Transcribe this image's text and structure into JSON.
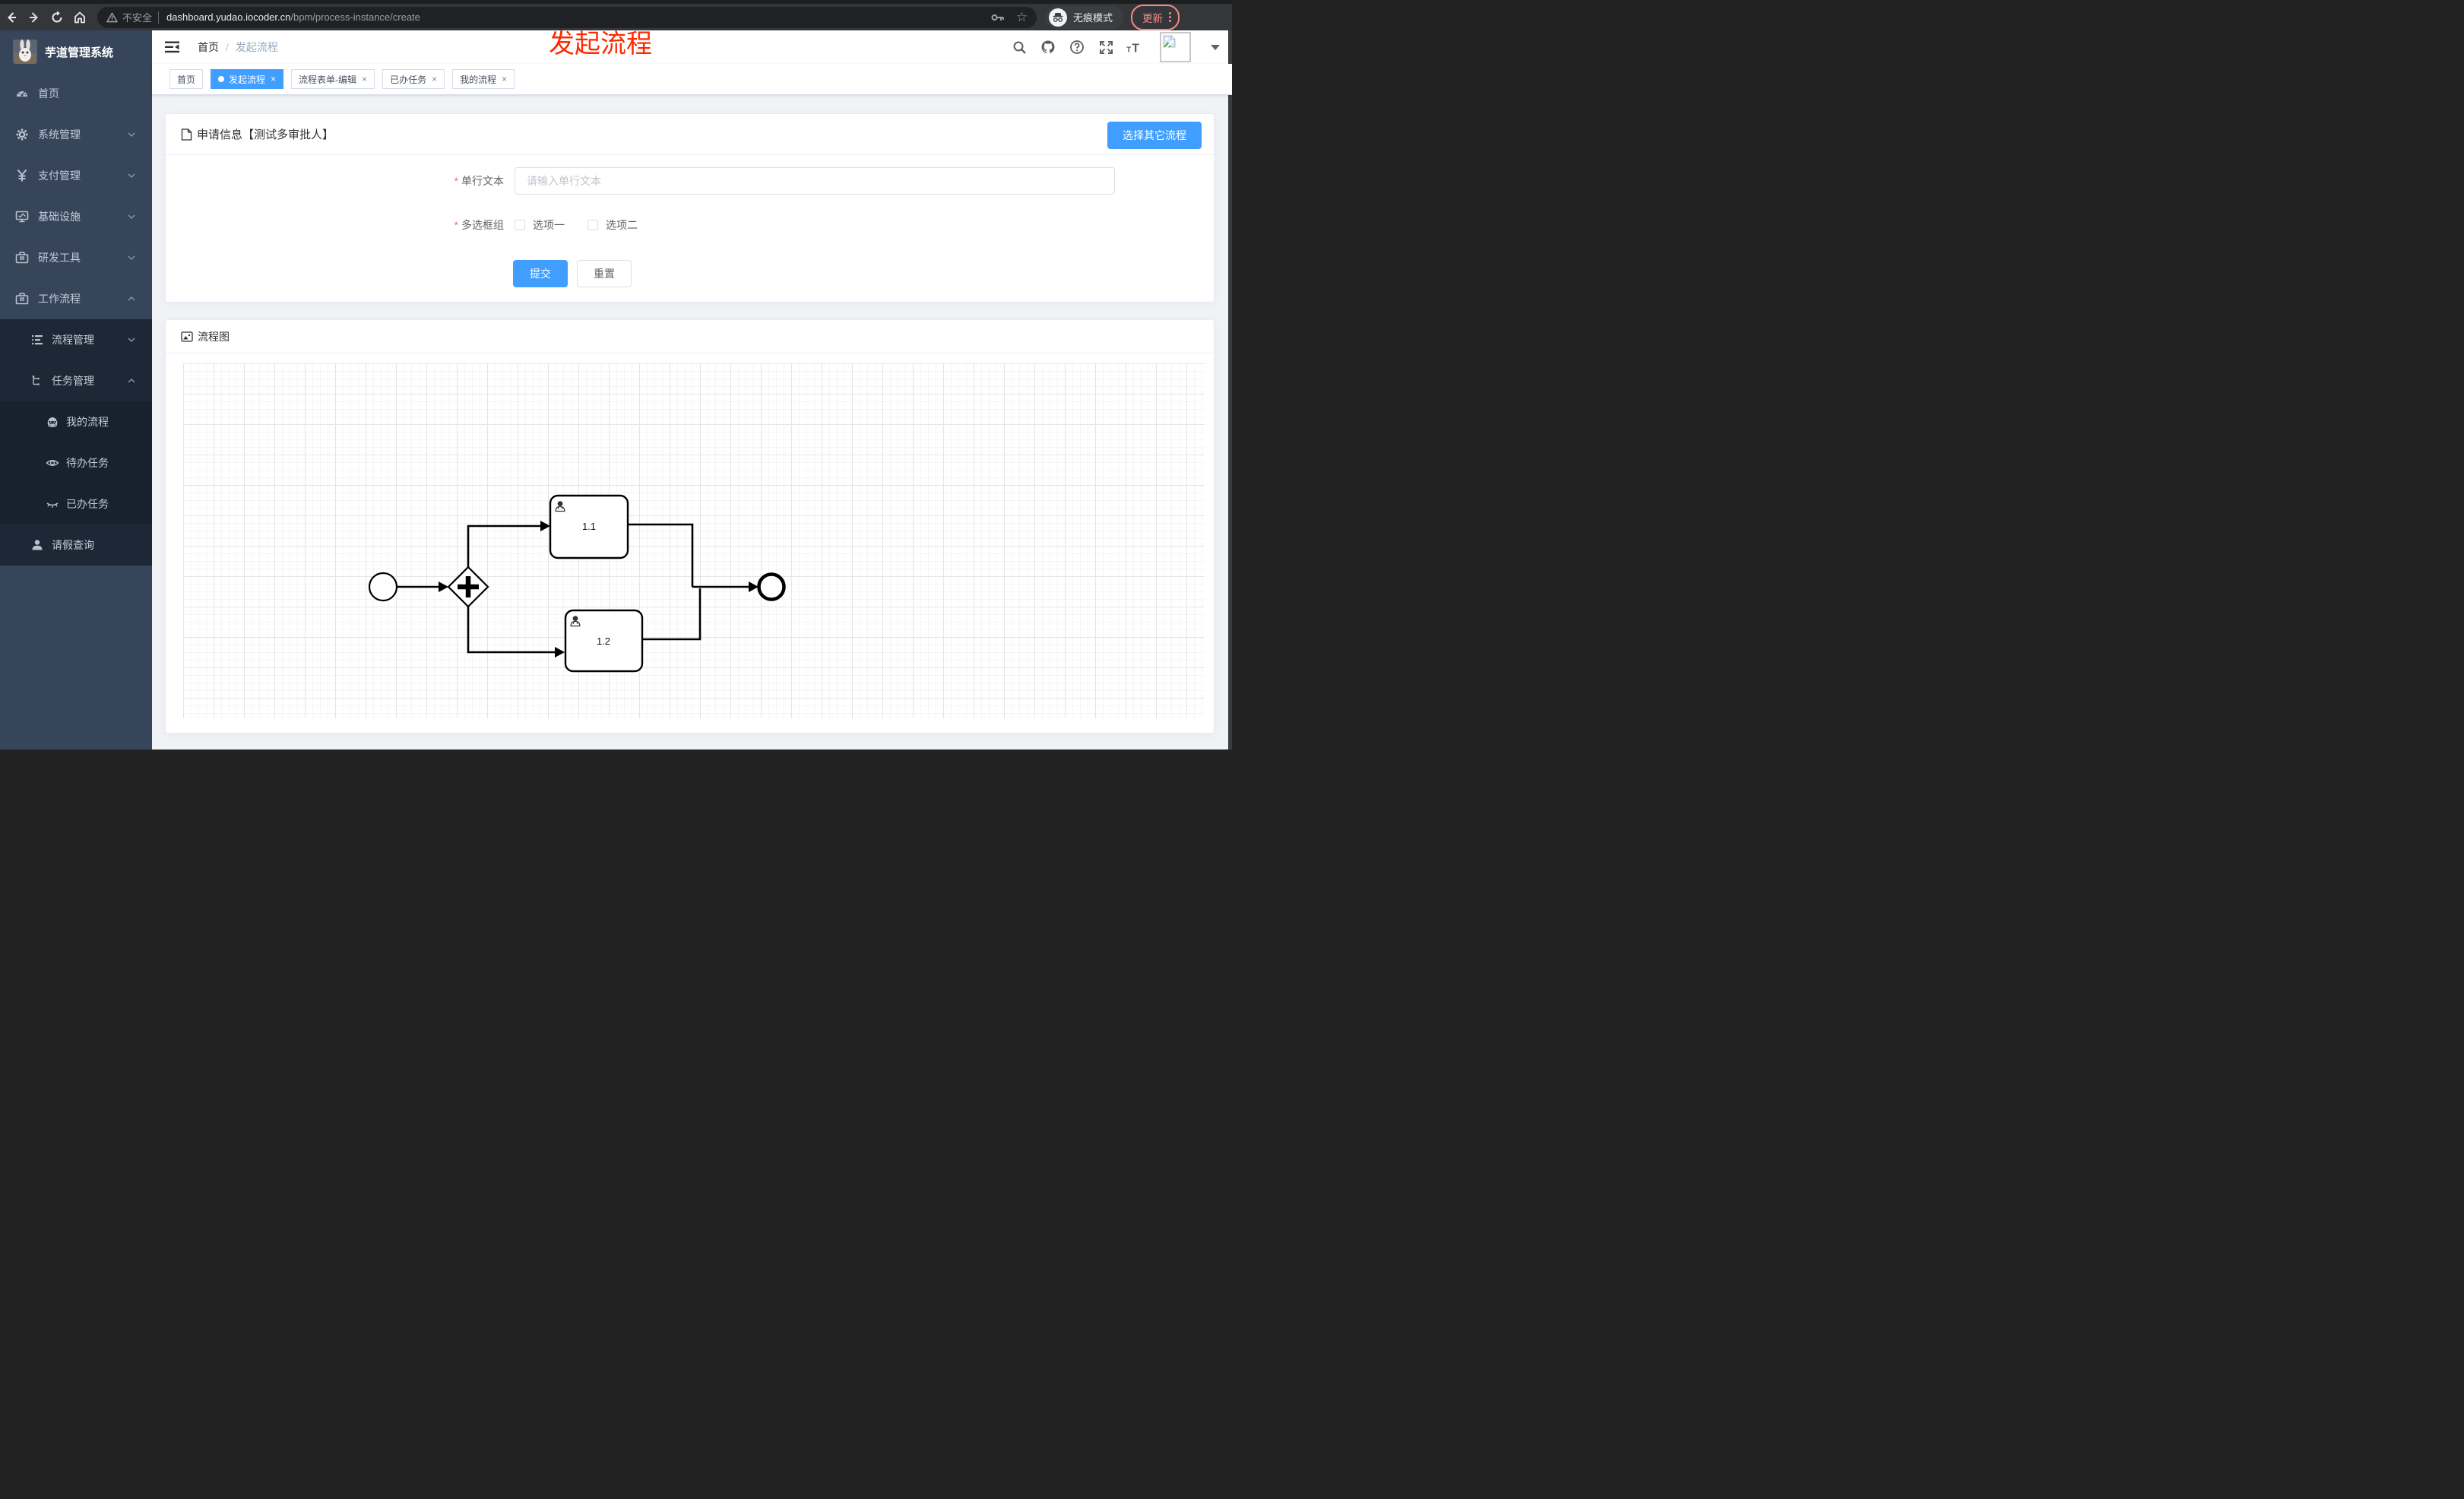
{
  "browser": {
    "security_label": "不安全",
    "url_domain": "dashboard.yudao.iocoder.cn",
    "url_path": "/bpm/process-instance/create",
    "incognito_label": "无痕模式",
    "update_label": "更新"
  },
  "annotation": {
    "text": "发起流程"
  },
  "sidebar": {
    "title": "芋道管理系统",
    "items": [
      {
        "label": "首页"
      },
      {
        "label": "系统管理"
      },
      {
        "label": "支付管理"
      },
      {
        "label": "基础设施"
      },
      {
        "label": "研发工具"
      },
      {
        "label": "工作流程"
      },
      {
        "label": "流程管理"
      },
      {
        "label": "任务管理"
      },
      {
        "label": "我的流程"
      },
      {
        "label": "待办任务"
      },
      {
        "label": "已办任务"
      },
      {
        "label": "请假查询"
      }
    ]
  },
  "breadcrumb": {
    "home": "首页",
    "separator": "/",
    "current": "发起流程"
  },
  "tabs": [
    {
      "label": "首页"
    },
    {
      "label": "发起流程"
    },
    {
      "label": "流程表单-编辑"
    },
    {
      "label": "已办任务"
    },
    {
      "label": "我的流程"
    }
  ],
  "apply_card": {
    "title": "申请信息【测试多审批人】",
    "select_other_button": "选择其它流程",
    "text_field": {
      "label": "单行文本",
      "placeholder": "请输入单行文本"
    },
    "checkbox_field": {
      "label": "多选框组",
      "option1": "选项一",
      "option2": "选项二"
    },
    "submit_label": "提交",
    "reset_label": "重置"
  },
  "diagram_card": {
    "title": "流程图",
    "task1_label": "1.1",
    "task2_label": "1.2"
  },
  "colors": {
    "accent": "#409eff",
    "sidebar_bg": "#36455a",
    "submenu_bg": "#1d2735",
    "update_red": "#f28b82",
    "annotation_red": "#ff2a00"
  }
}
